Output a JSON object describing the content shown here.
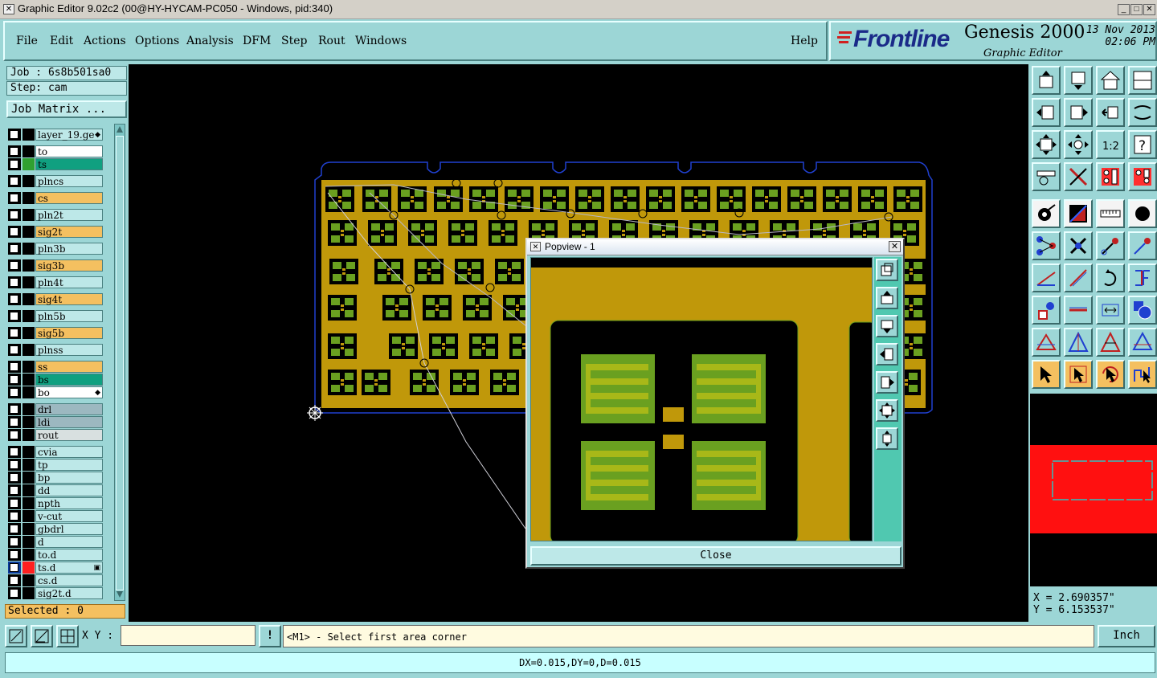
{
  "window": {
    "title": "Graphic Editor 9.02c2 (00@HY-HYCAM-PC050 - Windows, pid:340)",
    "min": "_",
    "max": "□",
    "close": "✕"
  },
  "menu": {
    "items": [
      "File",
      "Edit",
      "Actions",
      "Options",
      "Analysis",
      "DFM",
      "Step",
      "Rout",
      "Windows"
    ],
    "help": "Help"
  },
  "brand": {
    "logo": "Frontline",
    "product": "Genesis 2000",
    "subtitle": "Graphic Editor",
    "date": "13 Nov 2013",
    "time": "02:06 PM"
  },
  "job": {
    "job_label": "Job : 6s8b501sa0",
    "step_label": "Step: cam",
    "matrix_button": "Job Matrix ..."
  },
  "layers": [
    {
      "name": "layer_19.ge",
      "color": "#bde8e8",
      "swatch": "#000000",
      "mark": "◆",
      "gap_before": false
    },
    {
      "name": "to",
      "color": "#ffffff",
      "swatch": "#000000",
      "gap_before": true
    },
    {
      "name": "ts",
      "color": "#10a080",
      "swatch": "#30a030"
    },
    {
      "name": "plncs",
      "color": "#bde8e8",
      "swatch": "#000000",
      "gap_before": true
    },
    {
      "name": "cs",
      "color": "#f4c060",
      "swatch": "#000000",
      "gap_before": true
    },
    {
      "name": "pln2t",
      "color": "#bde8e8",
      "swatch": "#000000",
      "gap_before": true
    },
    {
      "name": "sig2t",
      "color": "#f4c060",
      "swatch": "#000000",
      "gap_before": true
    },
    {
      "name": "pln3b",
      "color": "#bde8e8",
      "swatch": "#000000",
      "gap_before": true
    },
    {
      "name": "sig3b",
      "color": "#f4c060",
      "swatch": "#000000",
      "gap_before": true
    },
    {
      "name": "pln4t",
      "color": "#bde8e8",
      "swatch": "#000000",
      "gap_before": true
    },
    {
      "name": "sig4t",
      "color": "#f4c060",
      "swatch": "#000000",
      "gap_before": true
    },
    {
      "name": "pln5b",
      "color": "#bde8e8",
      "swatch": "#000000",
      "gap_before": true
    },
    {
      "name": "sig5b",
      "color": "#f4c060",
      "swatch": "#000000",
      "gap_before": true
    },
    {
      "name": "plnss",
      "color": "#bde8e8",
      "swatch": "#000000",
      "gap_before": true
    },
    {
      "name": "ss",
      "color": "#f4c060",
      "swatch": "#000000",
      "gap_before": true
    },
    {
      "name": "bs",
      "color": "#10a080",
      "swatch": "#000000"
    },
    {
      "name": "bo",
      "color": "#ffffff",
      "swatch": "#000000",
      "mark": "◆"
    },
    {
      "name": "drl",
      "color": "#9cb8c0",
      "swatch": "#000000",
      "gap_before": true
    },
    {
      "name": "ldi",
      "color": "#9cb8c0",
      "swatch": "#000000"
    },
    {
      "name": "rout",
      "color": "#d8e0e0",
      "swatch": "#000000"
    },
    {
      "name": "cvia",
      "color": "#bde8e8",
      "swatch": "#000000",
      "gap_before": true
    },
    {
      "name": "tp",
      "color": "#bde8e8",
      "swatch": "#000000"
    },
    {
      "name": "bp",
      "color": "#bde8e8",
      "swatch": "#000000"
    },
    {
      "name": "dd",
      "color": "#bde8e8",
      "swatch": "#000000"
    },
    {
      "name": "npth",
      "color": "#bde8e8",
      "swatch": "#000000"
    },
    {
      "name": "v-cut",
      "color": "#bde8e8",
      "swatch": "#000000"
    },
    {
      "name": "gbdrl",
      "color": "#bde8e8",
      "swatch": "#000000"
    },
    {
      "name": "d",
      "color": "#bde8e8",
      "swatch": "#000000"
    },
    {
      "name": "to.d",
      "color": "#bde8e8",
      "swatch": "#000000"
    },
    {
      "name": "ts.d",
      "color": "#bde8e8",
      "swatch": "#ff2020",
      "active": true,
      "mark": "▣"
    },
    {
      "name": "cs.d",
      "color": "#bde8e8",
      "swatch": "#000000"
    },
    {
      "name": "sig2t.d",
      "color": "#bde8e8",
      "swatch": "#000000"
    }
  ],
  "selected": "Selected : 0",
  "coords": {
    "x": "X = 2.690357\"",
    "y": "Y = 6.153537\""
  },
  "bottom": {
    "xy_label": "X Y :",
    "xy_value": "",
    "bang": "!",
    "prompt": "<M1> - Select first area corner",
    "unit": "Inch"
  },
  "status": "DX=0.015,DY=0,D=0.015",
  "popview": {
    "title": "Popview - 1",
    "close_x": "✕",
    "close_button": "Close"
  },
  "colors": {
    "panel": "#9cd6d6",
    "copper": "#c0980a",
    "pad_green": "#6aa020",
    "outline_blue": "#2040d0",
    "layer_orange": "#f4c060"
  },
  "tools": [
    "move-up-icon",
    "move-down-icon",
    "home-icon",
    "window-icon",
    "move-left-icon",
    "move-right-icon",
    "undo-view-icon",
    "redo-view-icon",
    "fit-icon",
    "center-icon",
    "scale-icon",
    "help-icon",
    "snap-icon",
    "cut-icon",
    "layer-up-icon",
    "layer-down-icon",
    "pad-icon",
    "line-color-icon",
    "ruler-icon",
    "circle-icon",
    "node-icon",
    "cross-icon",
    "pin-icon",
    "pin2-icon",
    "angle-icon",
    "line-icon",
    "arc-icon",
    "split-icon",
    "point-icon",
    "dash-icon",
    "measure-icon",
    "shape-icon",
    "triangle-icon",
    "triangle2-icon",
    "triangle3-icon",
    "triangle4-icon",
    "pointer-icon",
    "pointer-box-icon",
    "pointer-rotate-icon",
    "pointer-route-icon"
  ]
}
